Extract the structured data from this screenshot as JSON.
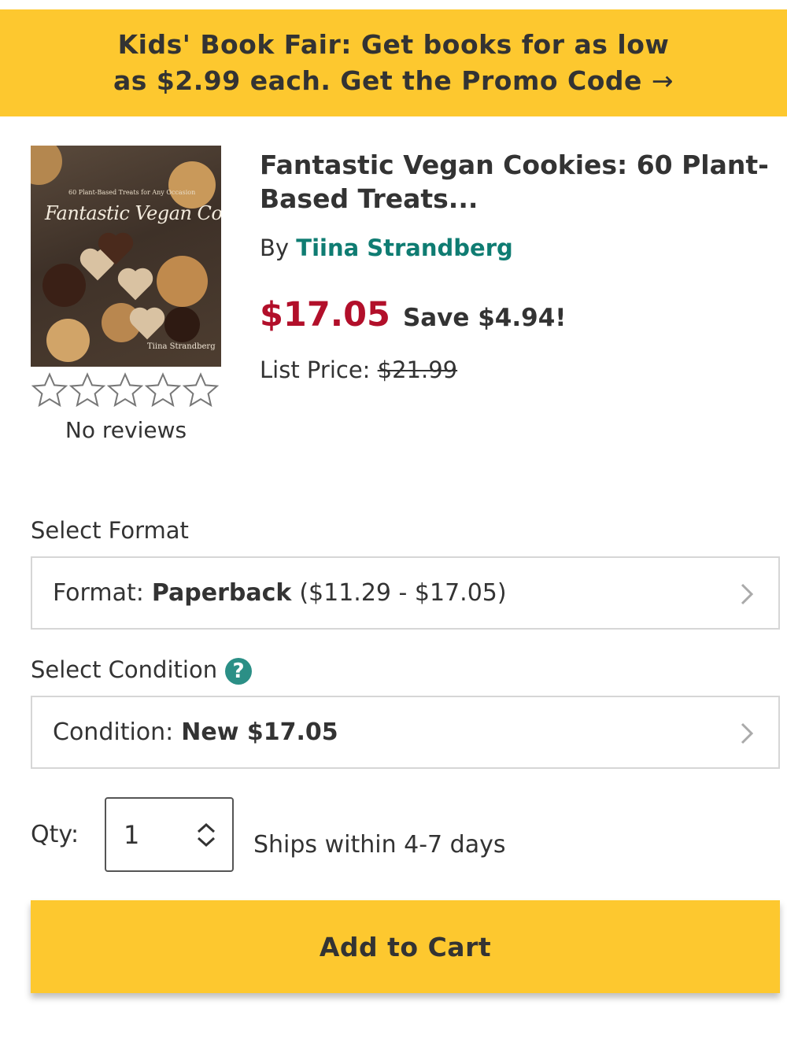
{
  "promo": {
    "line1": "Kids' Book Fair: Get books for as low",
    "line2": "as $2.99 each. Get the Promo Code",
    "arrow": "→"
  },
  "cover": {
    "subtitle": "60 Plant-Based Treats for Any Occasion",
    "title": "Fantastic Vegan Cookies",
    "author": "Tiina Strandberg"
  },
  "rating": {
    "stars": 0,
    "max": 5,
    "reviews_text": "No reviews"
  },
  "product": {
    "title": "Fantastic Vegan Cookies: 60 Plant-Based Treats...",
    "by_label": "By",
    "author": "Tiina Strandberg",
    "price": "$17.05",
    "save": "Save $4.94!",
    "list_price_label": "List Price:",
    "list_price": "$21.99"
  },
  "format": {
    "section_label": "Select Format",
    "prefix": "Format:",
    "value": "Paperback",
    "range": "($11.29 - $17.05)"
  },
  "condition": {
    "section_label": "Select Condition",
    "help_icon": "?",
    "prefix": "Condition:",
    "value": "New $17.05"
  },
  "quantity": {
    "label": "Qty:",
    "value": "1",
    "shipping": "Ships within 4-7 days"
  },
  "cart": {
    "button_label": "Add to Cart"
  },
  "colors": {
    "accent_yellow": "#fdc82f",
    "price_red": "#b20f2a",
    "author_teal": "#0f7c72",
    "help_teal": "#2b8f86"
  }
}
